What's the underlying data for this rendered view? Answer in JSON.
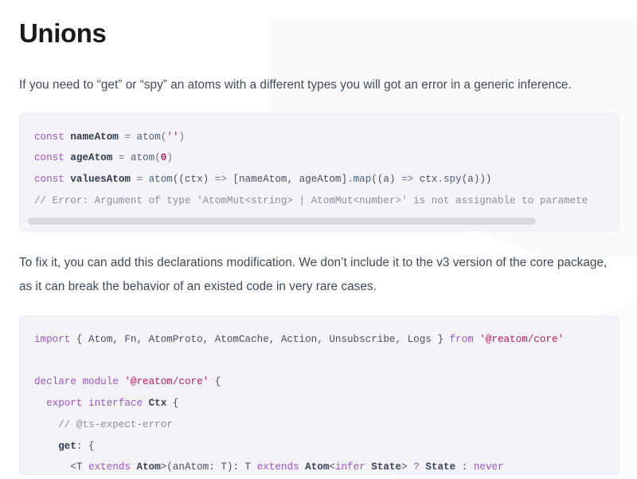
{
  "page": {
    "title": "Unions",
    "paragraph_1": "If you need to “get” or “spy” an atoms with a different types you will got an error in a generic inference.",
    "paragraph_2": "To fix it, you can add this declarations modification. We don’t include it to the v3 version of the core package, as it can break the behavior of an existed code in very rare cases."
  },
  "code_block_1": {
    "language": "typescript",
    "has_horizontal_scrollbar": true,
    "lines": [
      {
        "tokens": [
          {
            "text": "const",
            "type": "keyword"
          },
          {
            "text": " ",
            "type": "plain"
          },
          {
            "text": "nameAtom",
            "type": "name"
          },
          {
            "text": " = ",
            "type": "operator"
          },
          {
            "text": "atom",
            "type": "function"
          },
          {
            "text": "(",
            "type": "punct"
          },
          {
            "text": "''",
            "type": "string"
          },
          {
            "text": ")",
            "type": "punct"
          }
        ]
      },
      {
        "tokens": [
          {
            "text": "const",
            "type": "keyword"
          },
          {
            "text": " ",
            "type": "plain"
          },
          {
            "text": "ageAtom",
            "type": "name"
          },
          {
            "text": " = ",
            "type": "operator"
          },
          {
            "text": "atom",
            "type": "function"
          },
          {
            "text": "(",
            "type": "punct"
          },
          {
            "text": "0",
            "type": "number"
          },
          {
            "text": ")",
            "type": "punct"
          }
        ]
      },
      {
        "tokens": [
          {
            "text": "const",
            "type": "keyword"
          },
          {
            "text": " ",
            "type": "plain"
          },
          {
            "text": "valuesAtom",
            "type": "name"
          },
          {
            "text": " = ",
            "type": "operator"
          },
          {
            "text": "atom",
            "type": "function"
          },
          {
            "text": "((ctx) ",
            "type": "plain"
          },
          {
            "text": "=>",
            "type": "operator"
          },
          {
            "text": " [nameAtom, ageAtom]",
            "type": "plain"
          },
          {
            "text": ".",
            "type": "punct"
          },
          {
            "text": "map",
            "type": "function"
          },
          {
            "text": "((a) ",
            "type": "plain"
          },
          {
            "text": "=>",
            "type": "operator"
          },
          {
            "text": " ctx",
            "type": "plain"
          },
          {
            "text": ".",
            "type": "punct"
          },
          {
            "text": "spy",
            "type": "function"
          },
          {
            "text": "(a)))",
            "type": "plain"
          }
        ]
      },
      {
        "tokens": [
          {
            "text": "// Error: Argument of type 'AtomMut<string> | AtomMut<number>' is not assignable to paramete",
            "type": "comment"
          }
        ]
      }
    ]
  },
  "code_block_2": {
    "language": "typescript",
    "has_horizontal_scrollbar": false,
    "lines": [
      {
        "tokens": [
          {
            "text": "import",
            "type": "keyword"
          },
          {
            "text": " { Atom, Fn, AtomProto, AtomCache, Action, Unsubscribe, Logs } ",
            "type": "plain"
          },
          {
            "text": "from",
            "type": "keyword"
          },
          {
            "text": " ",
            "type": "plain"
          },
          {
            "text": "'@reatom/core'",
            "type": "string"
          }
        ]
      },
      {
        "tokens": []
      },
      {
        "tokens": [
          {
            "text": "declare module",
            "type": "keyword"
          },
          {
            "text": " ",
            "type": "plain"
          },
          {
            "text": "'@reatom/core'",
            "type": "string"
          },
          {
            "text": " {",
            "type": "plain"
          }
        ]
      },
      {
        "tokens": [
          {
            "text": "  ",
            "type": "plain"
          },
          {
            "text": "export interface",
            "type": "keyword"
          },
          {
            "text": " ",
            "type": "plain"
          },
          {
            "text": "Ctx",
            "type": "type"
          },
          {
            "text": " {",
            "type": "plain"
          }
        ]
      },
      {
        "tokens": [
          {
            "text": "    ",
            "type": "plain"
          },
          {
            "text": "// @ts-expect-error",
            "type": "comment"
          }
        ]
      },
      {
        "tokens": [
          {
            "text": "    ",
            "type": "plain"
          },
          {
            "text": "get",
            "type": "name"
          },
          {
            "text": ": {",
            "type": "plain"
          }
        ]
      },
      {
        "tokens": [
          {
            "text": "      ",
            "type": "plain"
          },
          {
            "text": "<T ",
            "type": "plain"
          },
          {
            "text": "extends",
            "type": "keyword"
          },
          {
            "text": " ",
            "type": "plain"
          },
          {
            "text": "Atom",
            "type": "type"
          },
          {
            "text": ">(anAtom: T): T ",
            "type": "plain"
          },
          {
            "text": "extends",
            "type": "keyword"
          },
          {
            "text": " ",
            "type": "plain"
          },
          {
            "text": "Atom",
            "type": "type"
          },
          {
            "text": "<",
            "type": "plain"
          },
          {
            "text": "infer",
            "type": "keyword"
          },
          {
            "text": " ",
            "type": "plain"
          },
          {
            "text": "State",
            "type": "type"
          },
          {
            "text": "> ",
            "type": "plain"
          },
          {
            "text": "?",
            "type": "keyword"
          },
          {
            "text": " ",
            "type": "plain"
          },
          {
            "text": "State",
            "type": "type"
          },
          {
            "text": " : ",
            "type": "plain"
          },
          {
            "text": "never",
            "type": "keyword"
          }
        ]
      }
    ]
  },
  "colors": {
    "keyword": "#9a54c9",
    "string": "#c2185b",
    "comment": "#8b8ba0",
    "code_background": "#f4f4f8",
    "text": "#3f4a58",
    "heading": "#1a1a1a"
  }
}
